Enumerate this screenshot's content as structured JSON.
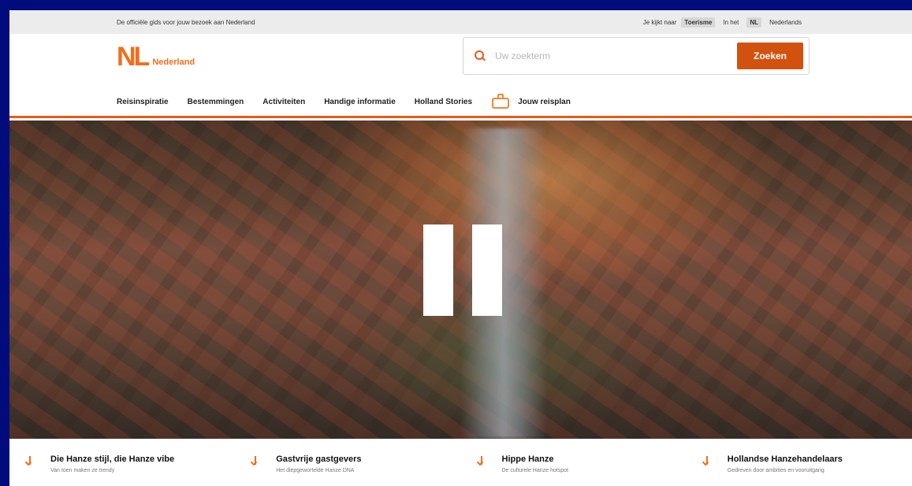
{
  "topbar": {
    "tagline": "De officiële gids voor jouw bezoek aan Nederland",
    "language_prompt": "Je kijkt naar",
    "languages": [
      {
        "label": "Toerisme",
        "active": true
      },
      {
        "label": "In het",
        "active": false
      },
      {
        "label": "NL",
        "active": true
      },
      {
        "label": "Nederlands",
        "active": false
      }
    ]
  },
  "logo": {
    "mark": "NL",
    "text": "Nederland"
  },
  "search": {
    "placeholder": "Uw zoekterm",
    "button_label": "Zoeken"
  },
  "nav": {
    "items": [
      {
        "label": "Reisinspiratie"
      },
      {
        "label": "Bestemmingen"
      },
      {
        "label": "Activiteiten"
      },
      {
        "label": "Handige informatie"
      },
      {
        "label": "Holland Stories"
      }
    ],
    "travel_plan_label": "Jouw reisplan"
  },
  "hero": {
    "state": "paused"
  },
  "features": [
    {
      "title": "Die Hanze stijl, die Hanze vibe",
      "subtitle": "Van toen maken ze trendy"
    },
    {
      "title": "Gastvrije gastgevers",
      "subtitle": "Het diepgewortelde Hanze DNA"
    },
    {
      "title": "Hippe Hanze",
      "subtitle": "De culturele Hanze hotspot"
    },
    {
      "title": "Hollandse Hanzehandelaars",
      "subtitle": "Gedreven door ambities en vooruitgang"
    }
  ],
  "colors": {
    "accent": "#e8591a",
    "button": "#d2510e",
    "page_border": "#000c7c"
  }
}
